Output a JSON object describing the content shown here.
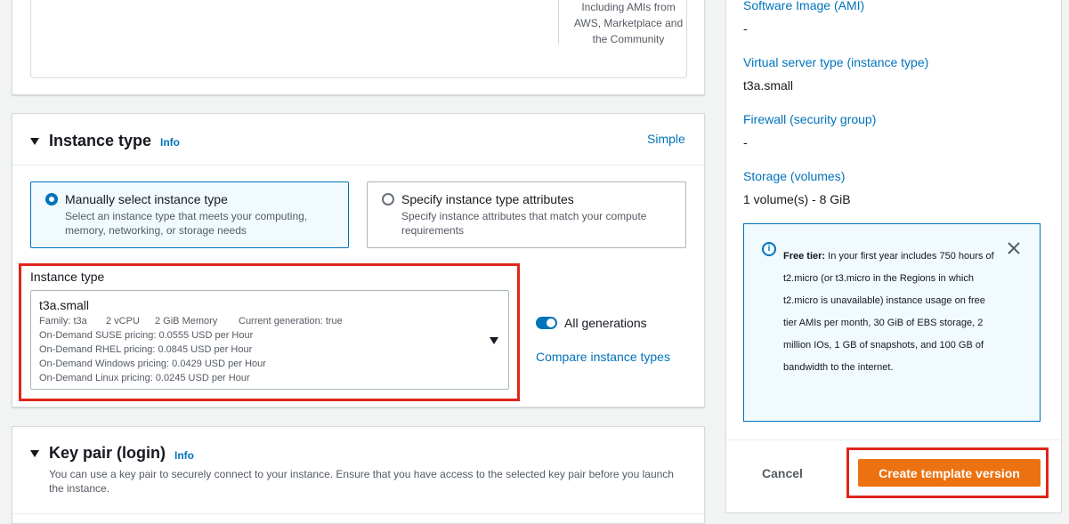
{
  "ami_section": {
    "caption_line1": "Including AMIs from",
    "caption_line2": "AWS, Marketplace and",
    "caption_line3": "the Community"
  },
  "instance_type_section": {
    "title": "Instance type",
    "info": "Info",
    "mode_link": "Simple",
    "options": [
      {
        "title": "Manually select instance type",
        "desc_line1": "Select an instance type that meets your computing,",
        "desc_line2": "memory, networking, or storage needs",
        "selected": true
      },
      {
        "title": "Specify instance type attributes",
        "desc_line1": "Specify instance attributes that match your compute",
        "desc_line2": "requirements",
        "selected": false
      }
    ],
    "field_label": "Instance type",
    "selected_value": "t3a.small",
    "details": {
      "family": "Family: t3a",
      "vcpu": "2 vCPU",
      "memory": "2 GiB Memory",
      "generation": "Current generation: true",
      "suse": "On-Demand SUSE pricing: 0.0555 USD per Hour",
      "rhel": "On-Demand RHEL pricing: 0.0845 USD per Hour",
      "windows": "On-Demand Windows pricing: 0.0429 USD per Hour",
      "linux": "On-Demand Linux pricing: 0.0245 USD per Hour"
    },
    "all_generations_label": "All generations",
    "all_generations_on": true,
    "compare_link": "Compare instance types"
  },
  "key_pair_section": {
    "title": "Key pair (login)",
    "info": "Info",
    "desc_line1": "You can use a key pair to securely connect to your instance. Ensure that you have access to the selected key pair before you launch",
    "desc_line2": "the instance."
  },
  "summary": {
    "ami_label": "Software Image (AMI)",
    "ami_value": "-",
    "instance_label": "Virtual server type (instance type)",
    "instance_value": "t3a.small",
    "firewall_label": "Firewall (security group)",
    "firewall_value": "-",
    "storage_label": "Storage (volumes)",
    "storage_value": "1 volume(s) - 8 GiB",
    "free_tier": {
      "bold": "Free tier:",
      "text": " In your first year includes 750 hours of t2.micro (or t3.micro in the Regions in which t2.micro is unavailable) instance usage on free tier AMIs per month, 30 GiB of EBS storage, 2 million IOs, 1 GB of snapshots, and 100 GB of bandwidth to the internet."
    },
    "cancel": "Cancel",
    "create": "Create template version"
  },
  "colors": {
    "accent": "#0073bb",
    "primary_button": "#ec7211",
    "highlight": "#e0251b"
  }
}
